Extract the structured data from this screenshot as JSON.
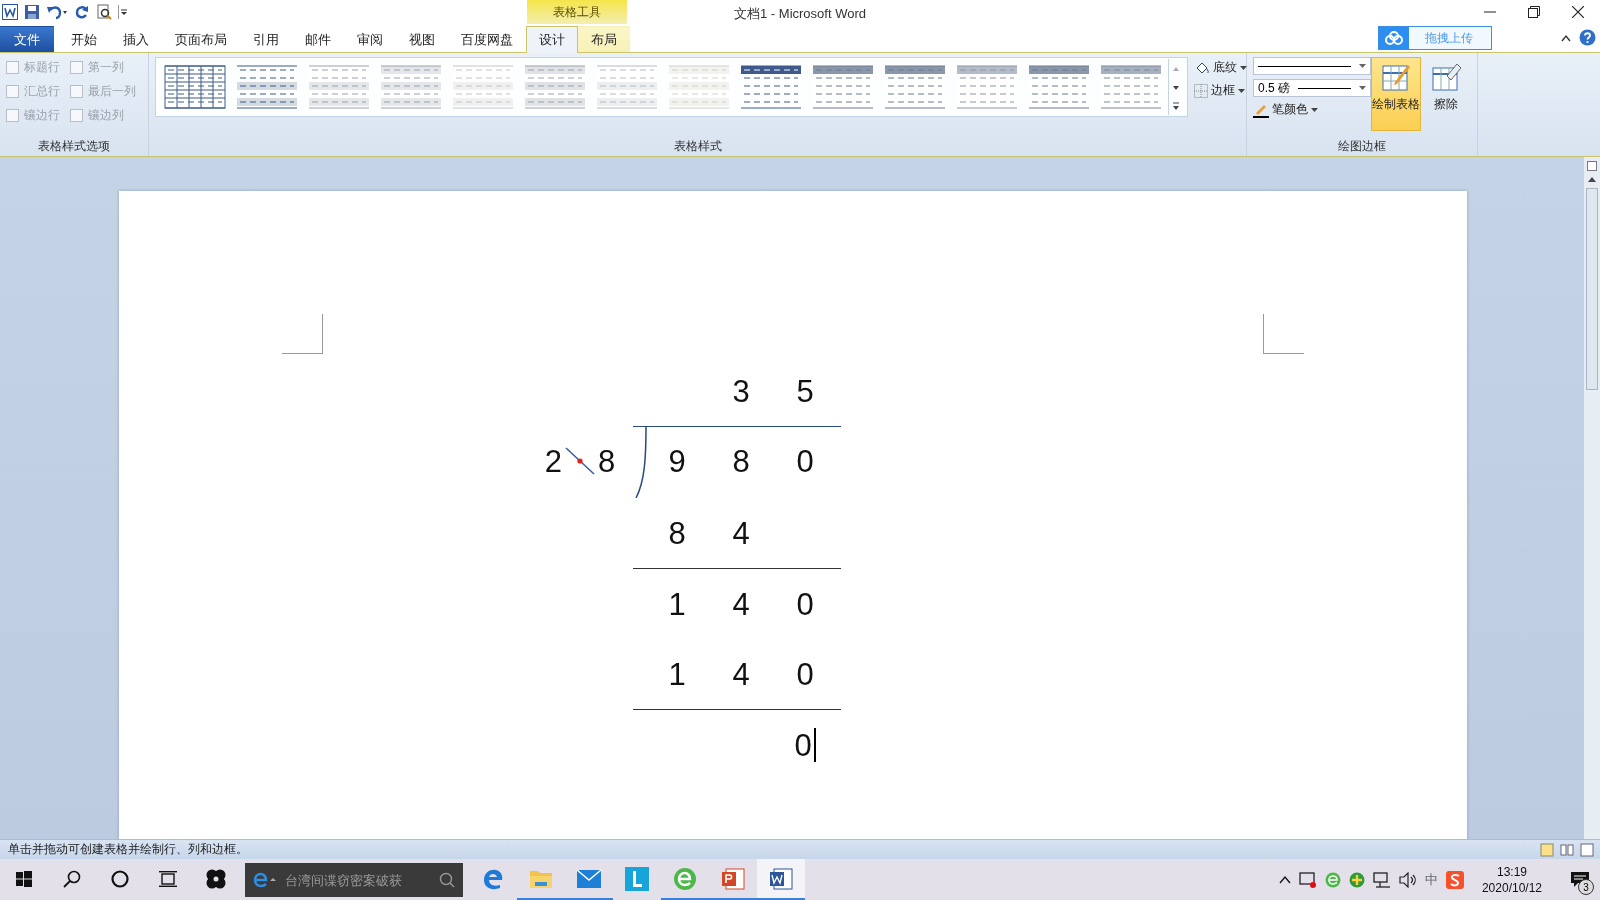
{
  "window": {
    "title": "文档1 - Microsoft Word"
  },
  "contextual_tab_group": {
    "label": "表格工具"
  },
  "tabs": [
    {
      "label": "文件",
      "kind": "file",
      "selected": false
    },
    {
      "label": "开始",
      "kind": "normal",
      "selected": false
    },
    {
      "label": "插入",
      "kind": "normal",
      "selected": false
    },
    {
      "label": "页面布局",
      "kind": "normal",
      "selected": false
    },
    {
      "label": "引用",
      "kind": "normal",
      "selected": false
    },
    {
      "label": "邮件",
      "kind": "normal",
      "selected": false
    },
    {
      "label": "审阅",
      "kind": "normal",
      "selected": false
    },
    {
      "label": "视图",
      "kind": "normal",
      "selected": false
    },
    {
      "label": "百度网盘",
      "kind": "normal",
      "selected": false
    },
    {
      "label": "设计",
      "kind": "context",
      "selected": true
    },
    {
      "label": "布局",
      "kind": "context",
      "selected": false
    }
  ],
  "upload_button": {
    "label": "拖拽上传"
  },
  "table_style_options": {
    "title": "表格样式选项",
    "checkboxes": [
      {
        "label": "标题行",
        "checked": false,
        "disabled": true
      },
      {
        "label": "汇总行",
        "checked": false,
        "disabled": true
      },
      {
        "label": "镶边行",
        "checked": false,
        "disabled": true
      },
      {
        "label": "第一列",
        "checked": false,
        "disabled": true
      },
      {
        "label": "最后一列",
        "checked": false,
        "disabled": true
      },
      {
        "label": "镶边列",
        "checked": false,
        "disabled": true
      }
    ]
  },
  "table_styles": {
    "title": "表格样式",
    "shading_button": "底纹",
    "borders_button": "边框"
  },
  "draw_borders": {
    "title": "绘图边框",
    "line_weight": "0.5 磅",
    "pen_color": "笔颜色",
    "draw_table": {
      "label": "绘制表格",
      "selected": true
    },
    "eraser": "擦除"
  },
  "division": {
    "divisor": [
      "2",
      "8"
    ],
    "rows": [
      {
        "kind": "quotient",
        "column_2": "3",
        "column_3": "5",
        "underlined": false
      },
      {
        "kind": "dividend",
        "column_1": "9",
        "column_2": "8",
        "column_3": "0",
        "underlined": false
      },
      {
        "kind": "step",
        "column_1": "8",
        "column_2": "4",
        "underlined": true
      },
      {
        "kind": "step",
        "column_1": "1",
        "column_2": "4",
        "column_3": "0",
        "underlined": false
      },
      {
        "kind": "step",
        "column_1": "1",
        "column_2": "4",
        "column_3": "0",
        "underlined": true
      },
      {
        "kind": "remainder",
        "column_3": "0",
        "underlined": false
      }
    ]
  },
  "status_bar": {
    "text": "单击并拖动可创建表格并绘制行、列和边框。"
  },
  "taskbar": {
    "search": {
      "placeholder": "台湾间谍窃密案破获"
    },
    "apps": [
      {
        "kind": "edge",
        "running": false,
        "active": false
      },
      {
        "kind": "folder",
        "running": true,
        "active": false
      },
      {
        "kind": "mail",
        "running": true,
        "active": false
      },
      {
        "kind": "l-app",
        "running": false,
        "active": false
      },
      {
        "kind": "green-e",
        "running": true,
        "active": false
      },
      {
        "kind": "slides",
        "running": true,
        "active": false
      },
      {
        "kind": "word",
        "running": true,
        "active": true
      }
    ],
    "ime": "中",
    "time": "13:19",
    "date": "2020/10/12",
    "notification_count": "3"
  }
}
